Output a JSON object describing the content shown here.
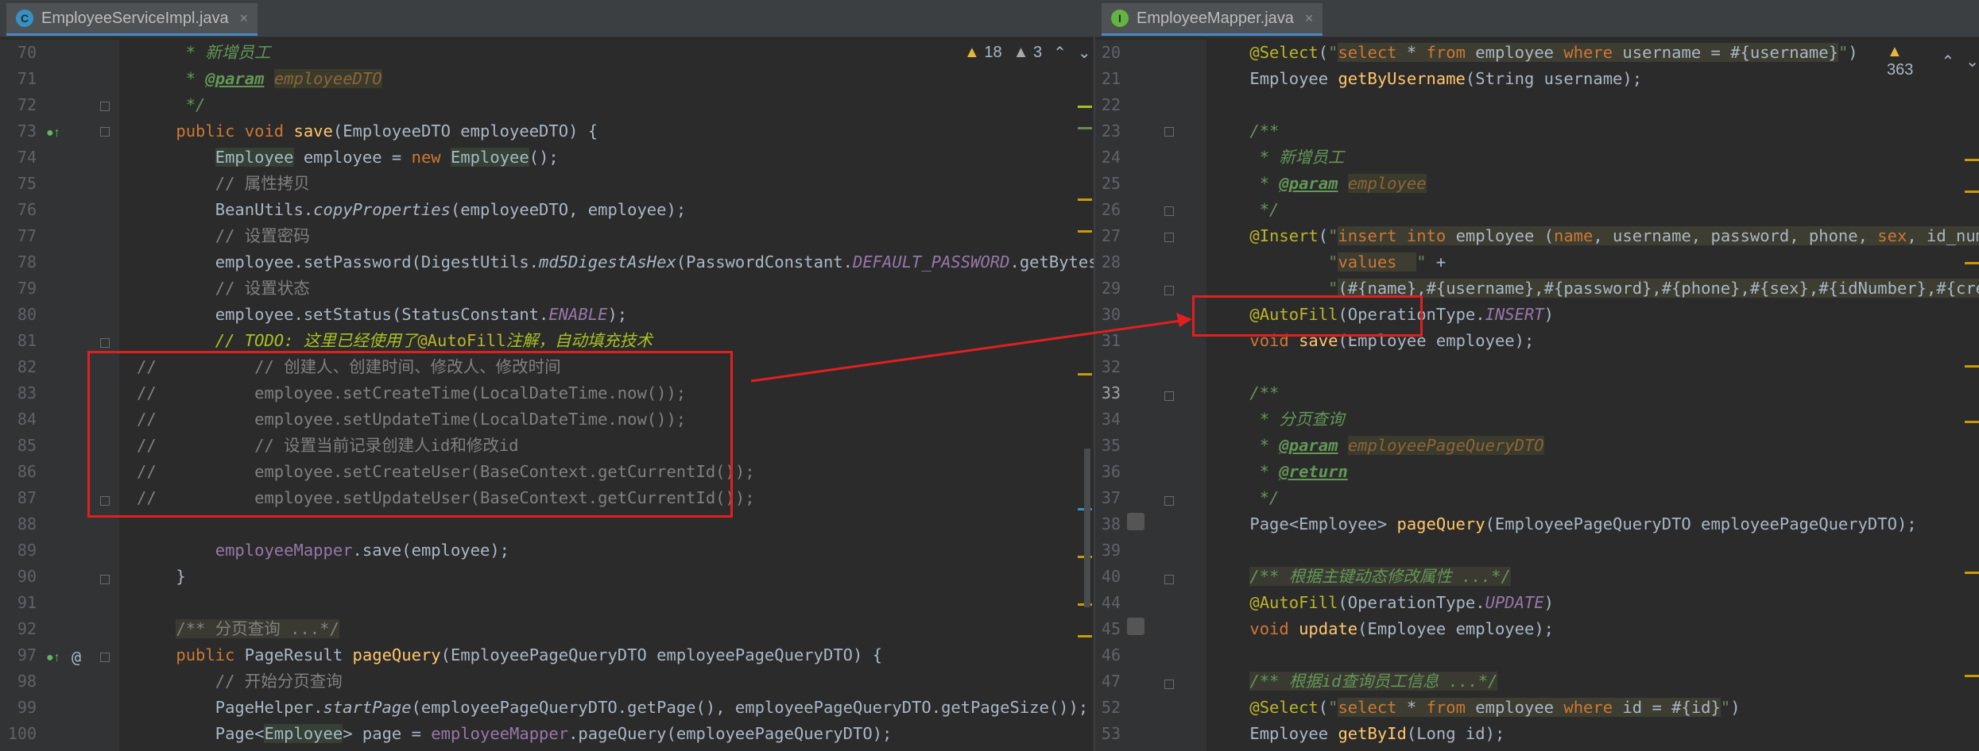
{
  "left": {
    "tab": {
      "icon": "C",
      "label": "EmployeeServiceImpl.java",
      "close": "×"
    },
    "badges": {
      "warn_count": "18",
      "weak_warn_count": "3"
    },
    "lines": [
      {
        "n": "70",
        "html": "<span class='cmi'>     * 新增员工</span>"
      },
      {
        "n": "71",
        "html": "<span class='cmi'>     * </span><span class='tag'>@param</span><span class='cmi'> </span><span class='prm it'>employeeDTO</span>"
      },
      {
        "n": "72",
        "html": "<span class='cmi'>     */</span>"
      },
      {
        "n": "73",
        "html": "    <span class='kw'>public void </span><span class='fn'>save</span>(EmployeeDTO employeeDTO) {"
      },
      {
        "n": "74",
        "html": "        <span class='hl'>Employee</span> employee = <span class='kw'>new </span><span class='hl'>Employee</span>();"
      },
      {
        "n": "75",
        "html": "        <span class='cm'>// 属性拷贝</span>"
      },
      {
        "n": "76",
        "html": "        BeanUtils.<span class='it'>copyProperties</span>(employeeDTO, employee);"
      },
      {
        "n": "77",
        "html": "        <span class='cm'>// 设置密码</span>"
      },
      {
        "n": "78",
        "html": "        employee.setPassword(DigestUtils.<span class='it'>md5DigestAsHex</span>(PasswordConstant.<span class='st'>DEFAULT_PASSWORD</span>.getBytes()));"
      },
      {
        "n": "79",
        "html": "        <span class='cm'>// 设置状态</span>"
      },
      {
        "n": "80",
        "html": "        employee.setStatus(StatusConstant.<span class='st'>ENABLE</span>);"
      },
      {
        "n": "81",
        "html": "        <span class='todo'>// TODO: 这里已经使用了</span><span class='an'>@AutoFill</span><span class='todo'>注解，自动填充技术</span>"
      },
      {
        "n": "82",
        "html": "<span class='cm'>//          // 创建人、创建时间、修改人、修改时间</span>"
      },
      {
        "n": "83",
        "html": "<span class='cm'>//          employee.setCreateTime(LocalDateTime.now());</span>"
      },
      {
        "n": "84",
        "html": "<span class='cm'>//          employee.setUpdateTime(LocalDateTime.now());</span>"
      },
      {
        "n": "85",
        "html": "<span class='cm'>//          // 设置当前记录创建人id和修改id</span>"
      },
      {
        "n": "86",
        "html": "<span class='cm'>//          employee.setCreateUser(BaseContext.getCurrentId());</span>"
      },
      {
        "n": "87",
        "html": "<span class='cm'>//          employee.setUpdateUser(BaseContext.getCurrentId());</span>"
      },
      {
        "n": "88",
        "html": ""
      },
      {
        "n": "89",
        "html": "        <span class='fd'>employeeMapper</span>.save(employee);"
      },
      {
        "n": "90",
        "html": "    }"
      },
      {
        "n": "91",
        "html": ""
      },
      {
        "n": "92",
        "html": "    <span class='fold cm'>/** 分页查询 ...*/</span>"
      },
      {
        "n": "97",
        "html": "    <span class='kw'>public </span>PageResult <span class='fn'>pageQuery</span>(EmployeePageQueryDTO employeePageQueryDTO) {"
      },
      {
        "n": "98",
        "html": "        <span class='cm'>// 开始分页查询</span>"
      },
      {
        "n": "99",
        "html": "        PageHelper.<span class='it'>startPage</span>(employeePageQueryDTO.getPage(), employeePageQueryDTO.getPageSize());"
      },
      {
        "n": "100",
        "html": "        Page&lt;<span class='hl'>Employee</span>&gt; page = <span class='fd'>employeeMapper</span>.pageQuery(employeePageQueryDTO);"
      }
    ]
  },
  "right": {
    "tab": {
      "icon": "I",
      "label": "EmployeeMapper.java",
      "close": "×"
    },
    "badges": {
      "warn_count": "363"
    },
    "lines": [
      {
        "n": "20",
        "html": "    <span class='an'>@Select</span>(<span class='str'>\"</span><span class='sql'><span class='sqk'>select</span> * <span class='sqk'>from</span> employee <span class='sqk'>where</span> username = #{username}</span><span class='str'>\"</span>)"
      },
      {
        "n": "21",
        "html": "    Employee <span class='fn'>getByUsername</span>(String username);"
      },
      {
        "n": "22",
        "html": ""
      },
      {
        "n": "23",
        "html": "    <span class='cmi'>/**</span>"
      },
      {
        "n": "24",
        "html": "<span class='cmi'>     * 新增员工</span>"
      },
      {
        "n": "25",
        "html": "<span class='cmi'>     * </span><span class='tag'>@param</span><span class='cmi'> </span><span class='prm it'>employee</span>"
      },
      {
        "n": "26",
        "html": "<span class='cmi'>     */</span>"
      },
      {
        "n": "27",
        "html": "    <span class='an'>@Insert</span>(<span class='str'>\"</span><span class='sql'><span class='sqk'>insert into</span> employee (<span class='sqk'>name</span>, username, password, phone, <span class='sqk'>sex</span>, id_number, c</span>"
      },
      {
        "n": "28",
        "html": "            <span class='str'>\"</span><span class='sql'><span class='sqk'>values</span>  </span><span class='str'>\"</span> +"
      },
      {
        "n": "29",
        "html": "            <span class='str'>\"</span><span class='sql'>(#{name},#{username},#{password},#{phone},#{sex},#{idNumber},#{createTim</span>"
      },
      {
        "n": "30",
        "html": "    <span class='an'>@AutoFill</span>(OperationType.<span class='st'>INSERT</span>)"
      },
      {
        "n": "31",
        "html": "    <span class='kw'>void </span><span class='fn'>save</span>(Employee employee);"
      },
      {
        "n": "32",
        "html": ""
      },
      {
        "n": "33",
        "html": "    <span class='cmi'>/**</span>"
      },
      {
        "n": "34",
        "html": "<span class='cmi'>     * 分页查询</span>"
      },
      {
        "n": "35",
        "html": "<span class='cmi'>     * </span><span class='tag'>@param</span><span class='cmi'> </span><span class='prm it'>employeePageQueryDTO</span>"
      },
      {
        "n": "36",
        "html": "<span class='cmi'>     * </span><span class='tag'>@return</span>"
      },
      {
        "n": "37",
        "html": "<span class='cmi'>     */</span>"
      },
      {
        "n": "38",
        "html": "    Page&lt;Employee&gt; <span class='fn'>pageQuery</span>(EmployeePageQueryDTO employeePageQueryDTO);"
      },
      {
        "n": "39",
        "html": ""
      },
      {
        "n": "40",
        "html": "    <span class='fold cmi'>/** 根据主键动态修改属性 ...*/</span>"
      },
      {
        "n": "44",
        "html": "    <span class='an'>@AutoFill</span>(OperationType.<span class='st'>UPDATE</span>)"
      },
      {
        "n": "45",
        "html": "    <span class='kw'>void </span><span class='fn'>update</span>(Employee employee);"
      },
      {
        "n": "46",
        "html": ""
      },
      {
        "n": "47",
        "html": "    <span class='fold cmi'>/** 根据id查询员工信息 ...*/</span>"
      },
      {
        "n": "52",
        "html": "    <span class='an'>@Select</span>(<span class='str'>\"</span><span class='sql'><span class='sqk'>select</span> * <span class='sqk'>from</span> employee <span class='sqk'>where</span> id = #{id}</span><span class='str'>\"</span>)"
      },
      {
        "n": "53",
        "html": "    Employee <span class='fn'>getById</span>(Long id);"
      }
    ]
  },
  "colors": {
    "annotation_box": "#e02020",
    "arrow": "#e02020",
    "background": "#2b2b2b"
  }
}
